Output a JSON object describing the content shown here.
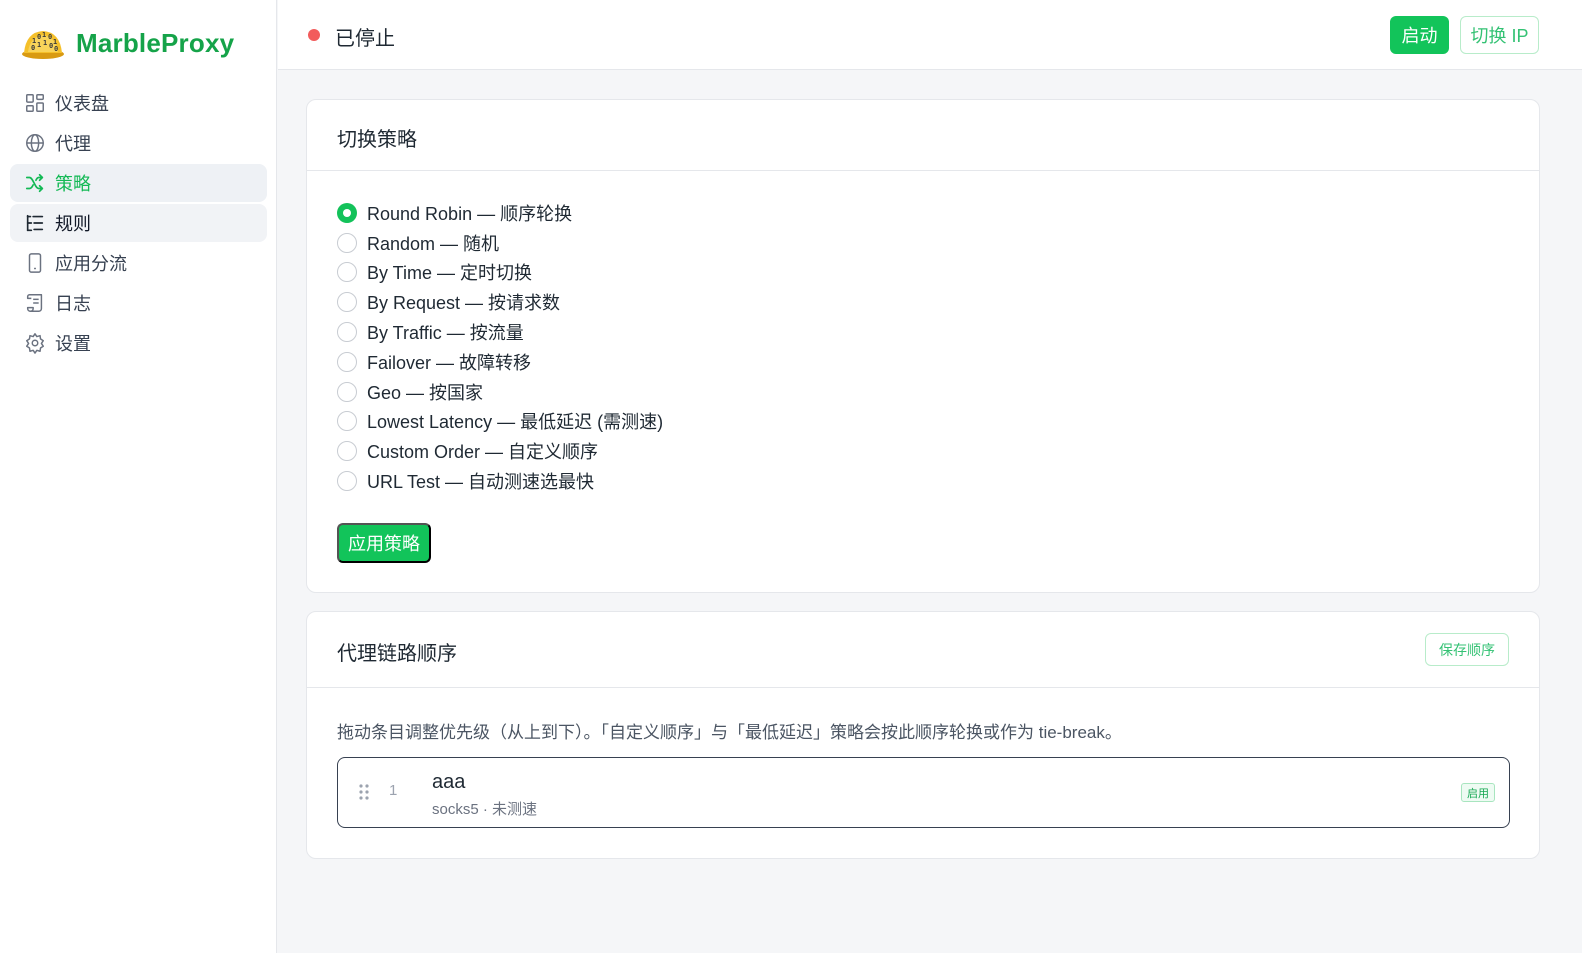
{
  "app": {
    "name": "MarbleProxy",
    "logo_icon": "marble-logo-icon"
  },
  "sidebar": {
    "items": [
      {
        "label": "仪表盘",
        "icon": "dashboard-icon"
      },
      {
        "label": "代理",
        "icon": "globe-icon"
      },
      {
        "label": "策略",
        "icon": "shuffle-icon",
        "active": true
      },
      {
        "label": "规则",
        "icon": "list-tree-icon",
        "hover": true
      },
      {
        "label": "应用分流",
        "icon": "phone-icon"
      },
      {
        "label": "日志",
        "icon": "scroll-icon"
      },
      {
        "label": "设置",
        "icon": "gear-icon"
      }
    ]
  },
  "topbar": {
    "status": "已停止",
    "status_color": "#f25c5c",
    "start_label": "启动",
    "switch_ip_label": "切换 IP"
  },
  "strategy": {
    "title": "切换策略",
    "options": [
      "Round Robin — 顺序轮换",
      "Random — 随机",
      "By Time — 定时切换",
      "By Request — 按请求数",
      "By Traffic — 按流量",
      "Failover — 故障转移",
      "Geo — 按国家",
      "Lowest Latency — 最低延迟 (需测速)",
      "Custom Order — 自定义顺序",
      "URL Test — 自动测速选最快"
    ],
    "selected_index": 0,
    "apply_label": "应用策略"
  },
  "chain": {
    "title": "代理链路顺序",
    "save_label": "保存顺序",
    "hint": "拖动条目调整优先级（从上到下）。「自定义顺序」与「最低延迟」策略会按此顺序轮换或作为 tie-break。",
    "items": [
      {
        "index": "1",
        "name": "aaa",
        "meta": "socks5 · 未测速",
        "tag": "启用"
      }
    ]
  },
  "colors": {
    "accent": "#12c45a",
    "brand": "#15a349",
    "danger": "#f25c5c"
  }
}
